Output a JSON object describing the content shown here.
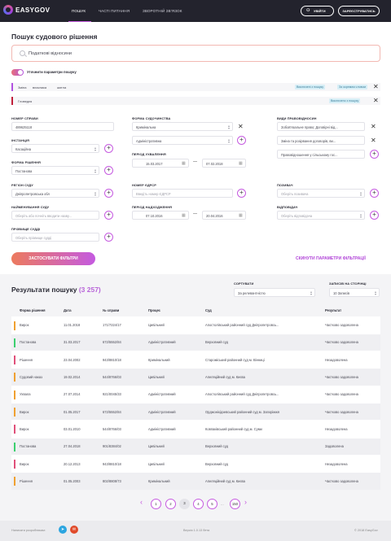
{
  "header": {
    "logo": "EASYGOV",
    "nav": [
      "ПОШУК",
      "ЧАСТІ ПИТАННЯ",
      "ЗВОРОТНІЙ ЗВ'ЯЗОК"
    ],
    "login": "УВІЙТИ",
    "register": "ЗАРЕЄСТРУВАТИСЬ"
  },
  "search": {
    "title": "Пошук судового рішення",
    "placeholder": "Податкові відносини",
    "refine_label": "Уточнити параметри пошуку"
  },
  "tags": [
    {
      "words": [
        "Зміна",
        "власника",
        "житла"
      ],
      "chips": [
        "Виключені з пошуку",
        "За окремим словом"
      ],
      "color": "#b152e0"
    },
    {
      "words": [
        "Гловедєя"
      ],
      "chips": [
        "Виключено з пошуку"
      ],
      "color": "#c0203a"
    }
  ],
  "filters": {
    "case_number": {
      "label": "НОМЕР СПРАВИ",
      "value": "489625118"
    },
    "instance": {
      "label": "ІНСТАНЦІЯ",
      "value": "Касаційна"
    },
    "decision_form": {
      "label": "ФОРМА РІШЕННЯ",
      "value": "Постанова"
    },
    "court_region": {
      "label": "РЕГІОН СУДУ",
      "value": "Дніпропетровська обл"
    },
    "court_name": {
      "label": "НАЙМЕНУВАННЯ СУДУ",
      "placeholder": "Оберіть або почніть вводити назву..."
    },
    "judge": {
      "label": "ПРІЗВИЩЕ СУДДІ",
      "placeholder": "Оберіть прізвище судді"
    },
    "proceeding_form": {
      "label": "ФОРМА СУДОЧИНСТВА",
      "values": [
        "Кримінальна",
        "Адміністративна"
      ]
    },
    "adoption_period": {
      "label": "ПЕРІОД УХВАЛЕННЯ",
      "from": "15.03.2017",
      "to": "07.02.2018"
    },
    "edrsr": {
      "label": "НОМЕР ЄДРСР",
      "placeholder": "Введіть номер ЄДРСР"
    },
    "receipt_period": {
      "label": "ПЕРІОД НАДХОДЖЕННЯ",
      "from": "07.10.2016",
      "to": "20.04.2016"
    },
    "legal_relations": {
      "label": "ВИДИ ПРАВОВІДНОСИН",
      "values": [
        "Зобов'язальне право; Договірні від...",
        "Зміна та розірвання договорів, ви...",
        "Правовідношення у сільському гос..."
      ]
    },
    "plaintiff": {
      "label": "ПОЗИВАЧ",
      "placeholder": "Оберіть позивача"
    },
    "defendant": {
      "label": "ВІДПОВІДАЧ",
      "placeholder": "Оберіть відповідача"
    }
  },
  "actions": {
    "apply": "ЗАСТОСУВАТИ ФІЛЬТРИ",
    "reset": "СКИНУТИ ПАРАМЕТРИ ФІЛЬТРАЦІЇ"
  },
  "results": {
    "title": "Результати пошуку",
    "count": "(3 257)",
    "sort_label": "СОРТУВАТИ",
    "sort_value": "За релевантністю",
    "per_page_label": "ЗАПИСІВ НА СТОРІНЦІ",
    "per_page_value": "10 Записів",
    "columns": [
      "Форма рішення",
      "Дата",
      "№ справи",
      "Процес",
      "Суд",
      "Результат"
    ],
    "rows": [
      {
        "form": "Вирок",
        "date": "11.01.2018",
        "case": "171/7224/17",
        "process": "Цивільний",
        "court": "Апостолівський районний суд Дніпропетровсь...",
        "result": "Частково задоволена",
        "color": "#f0a030"
      },
      {
        "form": "Постанова",
        "date": "31.03.2017",
        "case": "672/5552/84",
        "process": "Адміністративний",
        "court": "Верховний суд",
        "result": "Частково задоволена",
        "color": "#3ccf6e"
      },
      {
        "form": "Рішення",
        "date": "23.04.2002",
        "case": "943/8810/18",
        "process": "Кримінальний",
        "court": "Староміський районний суд м. Вінниці",
        "result": "Незадоволена",
        "color": "#e0507a"
      },
      {
        "form": "Судовий наказ",
        "date": "19.02.2014",
        "case": "544/8766/03",
        "process": "Цивільний",
        "court": "Апеляційний суд м. Києва",
        "result": "Частково задоволена",
        "color": "#f0a030"
      },
      {
        "form": "Ухвала",
        "date": "27.07.2014",
        "case": "921/0045/33",
        "process": "Адміністративний",
        "court": "Апостолівський районний суд Дніпропетровсь...",
        "result": "Частково задоволена",
        "color": "#f0a030"
      },
      {
        "form": "Вирок",
        "date": "01.05.2017",
        "case": "672/5552/84",
        "process": "Адміністративний",
        "court": "Орджонікідзевський районний суд м. Запоріжжя",
        "result": "Частково задоволена",
        "color": "#f0a030"
      },
      {
        "form": "Вирок",
        "date": "03.01.2010",
        "case": "544/8766/03",
        "process": "Адміністративний",
        "court": "Ковпаківський районний суд м. Суми",
        "result": "Незадоволена",
        "color": "#e0507a"
      },
      {
        "form": "Постанова",
        "date": "27.04.2018",
        "case": "901/8384/02",
        "process": "Цивільний",
        "court": "Верховний суд",
        "result": "Задоволена",
        "color": "#3ccf6e"
      },
      {
        "form": "Вирок",
        "date": "20.12.2013",
        "case": "943/8810/18",
        "process": "Цивільний",
        "court": "Верховний суд",
        "result": "Незадоволена",
        "color": "#e0507a"
      },
      {
        "form": "Рішення",
        "date": "01.05.2003",
        "case": "802/8808/73",
        "process": "Кримінальний",
        "court": "Апеляційний суд м. Києва",
        "result": "Частково задоволена",
        "color": "#f0a030"
      }
    ]
  },
  "pagination": {
    "pages": [
      "1",
      "2",
      "3",
      "4",
      "5",
      "...",
      "150"
    ],
    "current": "3"
  },
  "footer": {
    "share": "Написати розробникам:",
    "version": "Версія 1.0.13 бета",
    "copyright": "© 2018 EasyGov"
  },
  "colors": {
    "accent": "#c65be0",
    "header_bg": "#23232d",
    "cta_start": "#ec7a5e",
    "cta_end": "#c45ae0"
  }
}
